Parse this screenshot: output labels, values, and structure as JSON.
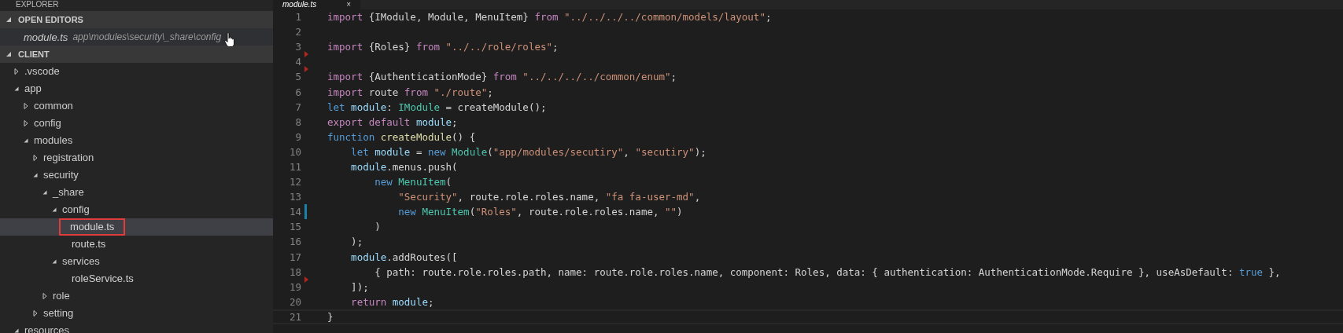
{
  "sidebar": {
    "title": "EXPLORER",
    "open_editors": {
      "title": "OPEN EDITORS",
      "expanded": true,
      "items": [
        {
          "name": "module.ts",
          "path": "app\\modules\\security\\_share\\config",
          "hovered": true
        }
      ]
    },
    "folder": {
      "title": "CLIENT",
      "expanded": true,
      "tree": [
        {
          "name": ".vscode",
          "kind": "folder",
          "expanded": false,
          "selected": false,
          "annotated": false
        },
        {
          "name": "app",
          "kind": "folder",
          "expanded": true,
          "selected": false,
          "annotated": false,
          "children": [
            {
              "name": "common",
              "kind": "folder",
              "expanded": false,
              "selected": false,
              "annotated": false
            },
            {
              "name": "config",
              "kind": "folder",
              "expanded": false,
              "selected": false,
              "annotated": false
            },
            {
              "name": "modules",
              "kind": "folder",
              "expanded": true,
              "selected": false,
              "annotated": false,
              "children": [
                {
                  "name": "registration",
                  "kind": "folder",
                  "expanded": false,
                  "selected": false,
                  "annotated": false
                },
                {
                  "name": "security",
                  "kind": "folder",
                  "expanded": true,
                  "selected": false,
                  "annotated": false,
                  "children": [
                    {
                      "name": "_share",
                      "kind": "folder",
                      "expanded": true,
                      "selected": false,
                      "annotated": false,
                      "children": [
                        {
                          "name": "config",
                          "kind": "folder",
                          "expanded": true,
                          "selected": false,
                          "annotated": false,
                          "children": [
                            {
                              "name": "module.ts",
                              "kind": "file",
                              "selected": true,
                              "annotated": true
                            },
                            {
                              "name": "route.ts",
                              "kind": "file",
                              "selected": false,
                              "annotated": false
                            }
                          ]
                        },
                        {
                          "name": "services",
                          "kind": "folder",
                          "expanded": true,
                          "selected": false,
                          "annotated": false,
                          "children": [
                            {
                              "name": "roleService.ts",
                              "kind": "file",
                              "selected": false,
                              "annotated": false
                            }
                          ]
                        }
                      ]
                    },
                    {
                      "name": "role",
                      "kind": "folder",
                      "expanded": false,
                      "selected": false,
                      "annotated": false
                    }
                  ]
                },
                {
                  "name": "setting",
                  "kind": "folder",
                  "expanded": false,
                  "selected": false,
                  "annotated": false
                }
              ]
            }
          ]
        },
        {
          "name": "resources",
          "kind": "folder",
          "expanded": true,
          "selected": false,
          "annotated": false
        }
      ]
    }
  },
  "editor": {
    "tabs": [
      {
        "label": "module.ts",
        "close": "×",
        "selected": true
      }
    ],
    "lines": [
      {
        "number": "1",
        "deleted": false,
        "modified": false,
        "current": false,
        "tokens": [
          {
            "kind": "kw",
            "text": "import"
          },
          {
            "kind": "text",
            "text": " {IModule, Module, MenuItem} "
          },
          {
            "kind": "kw",
            "text": "from"
          },
          {
            "kind": "str",
            "text": " \"../../../../common/models/layout\""
          },
          {
            "kind": "text",
            "text": ";"
          }
        ]
      },
      {
        "number": "2",
        "deleted": false,
        "modified": false,
        "current": false
      },
      {
        "number": "3",
        "deleted": true,
        "modified": false,
        "current": false,
        "tokens": [
          {
            "kind": "kw",
            "text": "import"
          },
          {
            "kind": "text",
            "text": " {Roles} "
          },
          {
            "kind": "kw",
            "text": "from"
          },
          {
            "kind": "str",
            "text": " \"../../role/roles\""
          },
          {
            "kind": "text",
            "text": ";"
          }
        ]
      },
      {
        "number": "4",
        "deleted": true,
        "modified": false,
        "current": false
      },
      {
        "number": "5",
        "deleted": false,
        "modified": false,
        "current": false,
        "tokens": [
          {
            "kind": "kw",
            "text": "import"
          },
          {
            "kind": "text",
            "text": " {AuthenticationMode} "
          },
          {
            "kind": "kw",
            "text": "from"
          },
          {
            "kind": "str",
            "text": " \"../../../../common/enum\""
          },
          {
            "kind": "text",
            "text": ";"
          }
        ]
      },
      {
        "number": "6",
        "deleted": false,
        "modified": false,
        "current": false,
        "tokens": [
          {
            "kind": "kw",
            "text": "import"
          },
          {
            "kind": "text",
            "text": " route "
          },
          {
            "kind": "kw",
            "text": "from"
          },
          {
            "kind": "str",
            "text": " \"./route\""
          },
          {
            "kind": "text",
            "text": ";"
          }
        ]
      },
      {
        "number": "7",
        "deleted": false,
        "modified": false,
        "current": false,
        "tokens": [
          {
            "kind": "storage",
            "text": "let"
          },
          {
            "kind": "var",
            "text": " module"
          },
          {
            "kind": "text",
            "text": ": "
          },
          {
            "kind": "type",
            "text": "IModule"
          },
          {
            "kind": "text",
            "text": " = createModule();"
          }
        ]
      },
      {
        "number": "8",
        "deleted": false,
        "modified": false,
        "current": false,
        "tokens": [
          {
            "kind": "kw",
            "text": "export default"
          },
          {
            "kind": "var",
            "text": " module"
          },
          {
            "kind": "text",
            "text": ";"
          }
        ]
      },
      {
        "number": "9",
        "deleted": false,
        "modified": false,
        "current": false,
        "tokens": [
          {
            "kind": "storage",
            "text": "function"
          },
          {
            "kind": "fn",
            "text": " createModule"
          },
          {
            "kind": "text",
            "text": "() {"
          }
        ]
      },
      {
        "number": "10",
        "deleted": false,
        "modified": false,
        "current": false,
        "tokens": [
          {
            "kind": "storage",
            "text": "    let"
          },
          {
            "kind": "var",
            "text": " module"
          },
          {
            "kind": "text",
            "text": " = "
          },
          {
            "kind": "storage",
            "text": "new"
          },
          {
            "kind": "type",
            "text": " Module"
          },
          {
            "kind": "text",
            "text": "("
          },
          {
            "kind": "str",
            "text": "\"app/modules/secutiry\""
          },
          {
            "kind": "text",
            "text": ", "
          },
          {
            "kind": "str",
            "text": "\"secutiry\""
          },
          {
            "kind": "text",
            "text": ");"
          }
        ]
      },
      {
        "number": "11",
        "deleted": false,
        "modified": false,
        "current": false,
        "tokens": [
          {
            "kind": "var",
            "text": "    module"
          },
          {
            "kind": "text",
            "text": ".menus.push("
          }
        ]
      },
      {
        "number": "12",
        "deleted": false,
        "modified": false,
        "current": false,
        "tokens": [
          {
            "kind": "storage",
            "text": "        new"
          },
          {
            "kind": "type",
            "text": " MenuItem"
          },
          {
            "kind": "text",
            "text": "("
          }
        ]
      },
      {
        "number": "13",
        "deleted": false,
        "modified": false,
        "current": false,
        "tokens": [
          {
            "kind": "str",
            "text": "            \"Security\""
          },
          {
            "kind": "text",
            "text": ", route.role.roles.name, "
          },
          {
            "kind": "str",
            "text": "\"fa fa-user-md\""
          },
          {
            "kind": "text",
            "text": ","
          }
        ]
      },
      {
        "number": "14",
        "deleted": false,
        "modified": true,
        "current": false,
        "tokens": [
          {
            "kind": "storage",
            "text": "            new"
          },
          {
            "kind": "type",
            "text": " MenuItem"
          },
          {
            "kind": "text",
            "text": "("
          },
          {
            "kind": "str",
            "text": "\"Roles\""
          },
          {
            "kind": "text",
            "text": ", route.role.roles.name, "
          },
          {
            "kind": "str",
            "text": "\"\""
          },
          {
            "kind": "text",
            "text": ")"
          }
        ]
      },
      {
        "number": "15",
        "deleted": false,
        "modified": false,
        "current": false,
        "tokens": [
          {
            "kind": "text",
            "text": "        )"
          }
        ]
      },
      {
        "number": "16",
        "deleted": false,
        "modified": false,
        "current": false,
        "tokens": [
          {
            "kind": "text",
            "text": "    );"
          }
        ]
      },
      {
        "number": "17",
        "deleted": false,
        "modified": false,
        "current": false,
        "tokens": [
          {
            "kind": "var",
            "text": "    module"
          },
          {
            "kind": "text",
            "text": ".addRoutes(["
          }
        ]
      },
      {
        "number": "18",
        "deleted": true,
        "modified": false,
        "current": false,
        "tokens": [
          {
            "kind": "text",
            "text": "        { path: route.role.roles.path, name: route.role.roles.name, component: Roles, data: { authentication: AuthenticationMode.Require }, useAsDefault: "
          },
          {
            "kind": "storage",
            "text": "true"
          },
          {
            "kind": "text",
            "text": " },"
          }
        ]
      },
      {
        "number": "19",
        "deleted": false,
        "modified": false,
        "current": false,
        "tokens": [
          {
            "kind": "text",
            "text": "    ]);"
          }
        ]
      },
      {
        "number": "20",
        "deleted": false,
        "modified": false,
        "current": false,
        "tokens": [
          {
            "kind": "kw",
            "text": "    return"
          },
          {
            "kind": "var",
            "text": " module"
          },
          {
            "kind": "text",
            "text": ";"
          }
        ]
      },
      {
        "number": "21",
        "deleted": false,
        "modified": false,
        "current": true,
        "tokens": [
          {
            "kind": "text",
            "text": "}"
          }
        ]
      }
    ]
  }
}
